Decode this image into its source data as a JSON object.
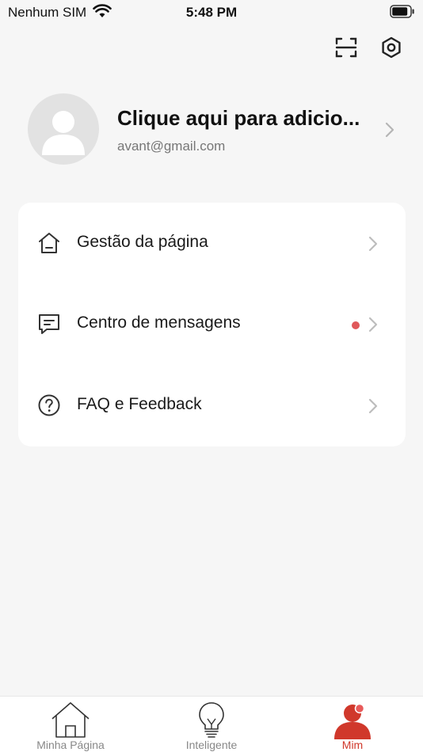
{
  "status_bar": {
    "carrier": "Nenhum SIM",
    "time": "5:48 PM"
  },
  "header_actions": {
    "icons": [
      "scan-icon",
      "settings-icon"
    ]
  },
  "profile": {
    "name": "Clique aqui para adicio...",
    "email": "avant@gmail.com"
  },
  "menu": {
    "items": [
      {
        "label": "Gestão da página",
        "icon": "home-icon",
        "unread": false
      },
      {
        "label": "Centro de mensagens",
        "icon": "message-icon",
        "unread": true
      },
      {
        "label": "FAQ e Feedback",
        "icon": "help-icon",
        "unread": false
      }
    ]
  },
  "tab_bar": {
    "tabs": [
      {
        "label": "Minha Página",
        "icon": "house-icon",
        "active": false
      },
      {
        "label": "Inteligente",
        "icon": "lightbulb-icon",
        "active": false
      },
      {
        "label": "Mim",
        "icon": "person-icon",
        "active": true
      }
    ]
  },
  "colors": {
    "accent": "#d0382b",
    "unread_dot": "#e0585a",
    "background": "#f6f6f6",
    "card": "#ffffff"
  }
}
